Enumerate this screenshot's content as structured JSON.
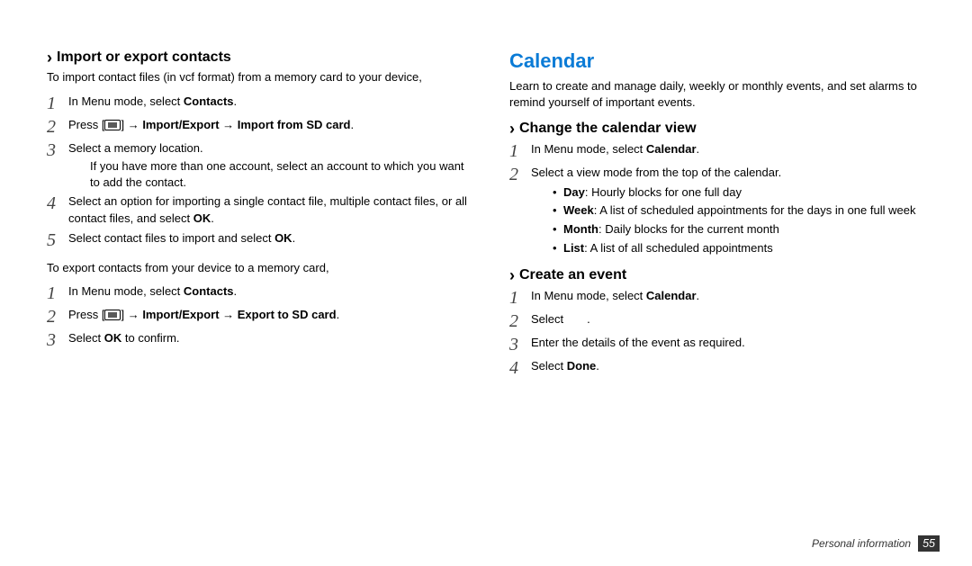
{
  "left": {
    "heading": "Import or export contacts",
    "intro": "To import contact files (in vcf format) from a memory card to your device,",
    "importSteps": [
      {
        "pre": "In Menu mode, select ",
        "bold": "Contacts",
        "post": "."
      },
      {
        "pre": "Press [",
        "post": "] → ",
        "bold": "Import/Export → Import from SD card",
        "after": "."
      },
      {
        "pre": "Select a memory location.",
        "note": "If you have more than one account, select an account to which you want to add the contact."
      },
      {
        "pre": "Select an option for importing a single contact file, multiple contact files, or all contact files, and select ",
        "bold": "OK",
        "post": "."
      },
      {
        "pre": "Select contact files to import and select ",
        "bold": "OK",
        "post": "."
      }
    ],
    "exportIntro": "To export contacts from your device to a memory card,",
    "exportSteps": [
      {
        "pre": "In Menu mode, select ",
        "bold": "Contacts",
        "post": "."
      },
      {
        "pre": "Press [",
        "post": "] → ",
        "bold": "Import/Export → Export to SD card",
        "after": "."
      },
      {
        "pre": "Select ",
        "bold": "OK",
        "post": " to confirm."
      }
    ]
  },
  "right": {
    "title": "Calendar",
    "intro": "Learn to create and manage daily, weekly or monthly events, and set alarms to remind yourself of important events.",
    "sec1": {
      "heading": "Change the calendar view",
      "steps": [
        {
          "pre": "In Menu mode, select ",
          "bold": "Calendar",
          "post": "."
        },
        {
          "pre": "Select a view mode from the top of the calendar."
        }
      ],
      "bullets": [
        {
          "bold": "Day",
          "text": ": Hourly blocks for one full day"
        },
        {
          "bold": "Week",
          "text": ": A list of scheduled appointments for the days in one full week"
        },
        {
          "bold": "Month",
          "text": ": Daily blocks for the current month"
        },
        {
          "bold": "List",
          "text": ": A list of all scheduled appointments"
        }
      ]
    },
    "sec2": {
      "heading": "Create an event",
      "steps": [
        {
          "pre": "In Menu mode, select ",
          "bold": "Calendar",
          "post": "."
        },
        {
          "pre": "Select  ."
        },
        {
          "pre": "Enter the details of the event as required."
        },
        {
          "pre": "Select ",
          "bold": "Done",
          "post": "."
        }
      ]
    }
  },
  "footer": {
    "label": "Personal information",
    "page": "55"
  }
}
